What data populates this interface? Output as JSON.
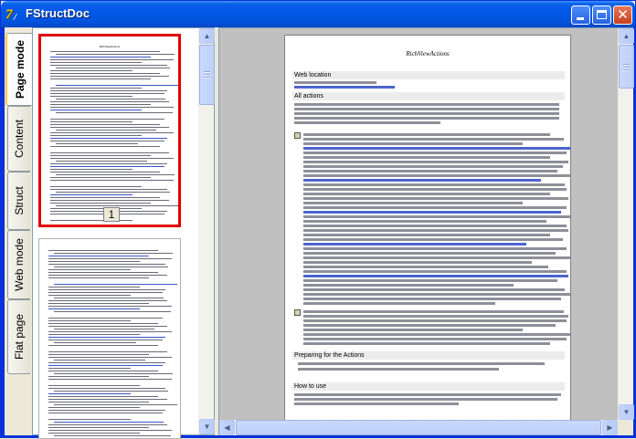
{
  "window": {
    "title": "FStructDoc",
    "icon_glyph": "7/",
    "buttons": [
      "minimize-icon",
      "maximize-icon",
      "close-icon"
    ],
    "close_glyph": "✕"
  },
  "tabs": [
    {
      "label": "Page mode",
      "active": true
    },
    {
      "label": "Content",
      "active": false
    },
    {
      "label": "Struct",
      "active": false
    },
    {
      "label": "Web mode",
      "active": false
    },
    {
      "label": "Flat page",
      "active": false
    }
  ],
  "thumbnails": {
    "selected_page_number": "1",
    "colors": {
      "selection": "#E00000"
    }
  },
  "scroll_arrows": {
    "up": "▲",
    "down": "▼",
    "left": "◀",
    "right": "▶"
  },
  "document": {
    "page_title": "RichViewActions",
    "sections": [
      "Web location",
      "All actions",
      "Preparing for the Actions",
      "How to use"
    ]
  },
  "colors": {
    "titlebar": "#0058E6",
    "frame": "#0831D9",
    "tab_face": "#ECE9D8",
    "link": "#3A54C8"
  }
}
